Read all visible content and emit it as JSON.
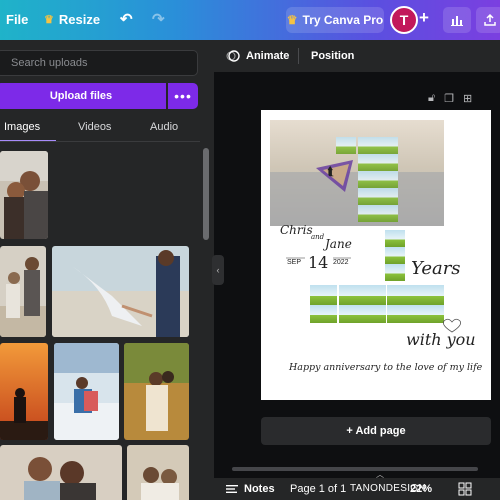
{
  "topbar": {
    "file": "File",
    "resize": "Resize",
    "try_pro": "Try Canva Pro",
    "avatar_initial": "T"
  },
  "panel": {
    "search_placeholder": "Search uploads",
    "upload_label": "Upload files",
    "more": "•••",
    "tabs": [
      "Images",
      "Videos",
      "Audio"
    ]
  },
  "context_bar": {
    "animate": "Animate",
    "position": "Position"
  },
  "canvas": {
    "name1": "Chris",
    "and": "and",
    "name2": "Jane",
    "date_month": "SEP",
    "date_day": "14",
    "date_year": "2022",
    "years": "Years",
    "with_you": "with you",
    "message": "Happy anniversary to the love of my life"
  },
  "add_page": "+ Add page",
  "bottombar": {
    "notes": "Notes",
    "page": "Page 1 of 1",
    "watermark": "TANONDESIGN",
    "zoom": "22%"
  },
  "colors": {
    "accent": "#7d2ae8",
    "tab_underline": "#a78bfa",
    "avatar": "#c2185b"
  }
}
